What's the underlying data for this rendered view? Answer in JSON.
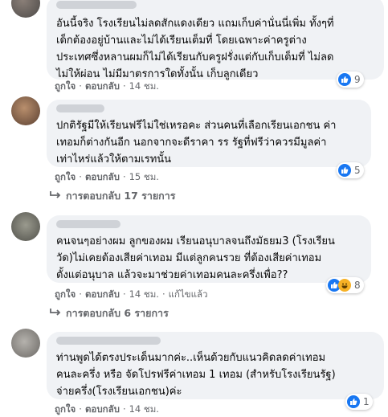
{
  "comments": [
    {
      "text": "อันนี้จริง โรงเรียนไม่ลดสักแดงเดียว แถมเก็บค่านั่นนี่เพิ่ม ทั้งๆที่\nเด็กต้องอยู่บ้านและไม่ได้เรียนเต็มที่ โดยเฉพาะค่าครูต่าง\nประเทศซึ่งหลานผมก็ไม่ได้เรียนกับครูฝรั่งแต่กับเก็บเต็มที่ ไม่ลด\nไม่ให้ผ่อน ไม่มีมาตรการใดทั้งนั้น เก็บลูกเดียว",
      "like": "ถูกใจ",
      "reply": "ตอบกลับ",
      "time": "14 ชม.",
      "edited": "",
      "reaction_count": "9",
      "reactions": [
        "like-icon"
      ]
    },
    {
      "text": "ปกติรัฐมีให้เรียนฟรีไม่ใช่เหรอคะ ส่วนคนที่เลือกเรียนเอกชน ค่า\nเทอมก็ต่างกันอีก นอกจากจะดีราคา รร รัฐที่ฟรีว่าควรมีมูลค่า\nเท่าไหร่แล้วให้ตามเรทนั้น",
      "like": "ถูกใจ",
      "reply": "ตอบกลับ",
      "time": "15 ชม.",
      "edited": "",
      "reaction_count": "5",
      "reactions": [
        "like-icon"
      ],
      "replies_label": "การตอบกลับ 17 รายการ"
    },
    {
      "text": "คนจนๆอย่างผม ลูกของผม เรียนอนุบาลจนถึงมัธยม3 (โรงเรียน\nวัด)ไม่เคยต้องเสียค่าเทอม มีแต่ลูกคนรวย ที่ต้องเสียค่าเทอม\nตั้งแต่อนุบาล แล้วจะมาช่วยค่าเทอมคนละครึ่งเพื่อ??",
      "like": "ถูกใจ",
      "reply": "ตอบกลับ",
      "time": "14 ชม.",
      "edited": "แก้ไขแล้ว",
      "reaction_count": "8",
      "reactions": [
        "like-icon",
        "haha-icon"
      ],
      "replies_label": "การตอบกลับ 6 รายการ"
    },
    {
      "text": "ท่านพูดได้ตรงประเด็นมากค่ะ..เห็นด้วยกับแนวคิดลดค่าเทอม\nคนละครึ่ง หรือ จัดโปรฟรีค่าเทอม 1 เทอม (สำหรับโรงเรียนรัฐ)\nจ่ายครึ่ง(โรงเรียนเอกชน)ค่ะ",
      "like": "ถูกใจ",
      "reply": "ตอบกลับ",
      "time": "14 ชม.",
      "edited": "",
      "reaction_count": "1",
      "reactions": [
        "like-icon"
      ]
    }
  ],
  "colors": {
    "bubble": "#f0f2f5",
    "meta_text": "#65676b",
    "like_blue": "#1877f2",
    "haha_yellow": "#f7b125"
  }
}
